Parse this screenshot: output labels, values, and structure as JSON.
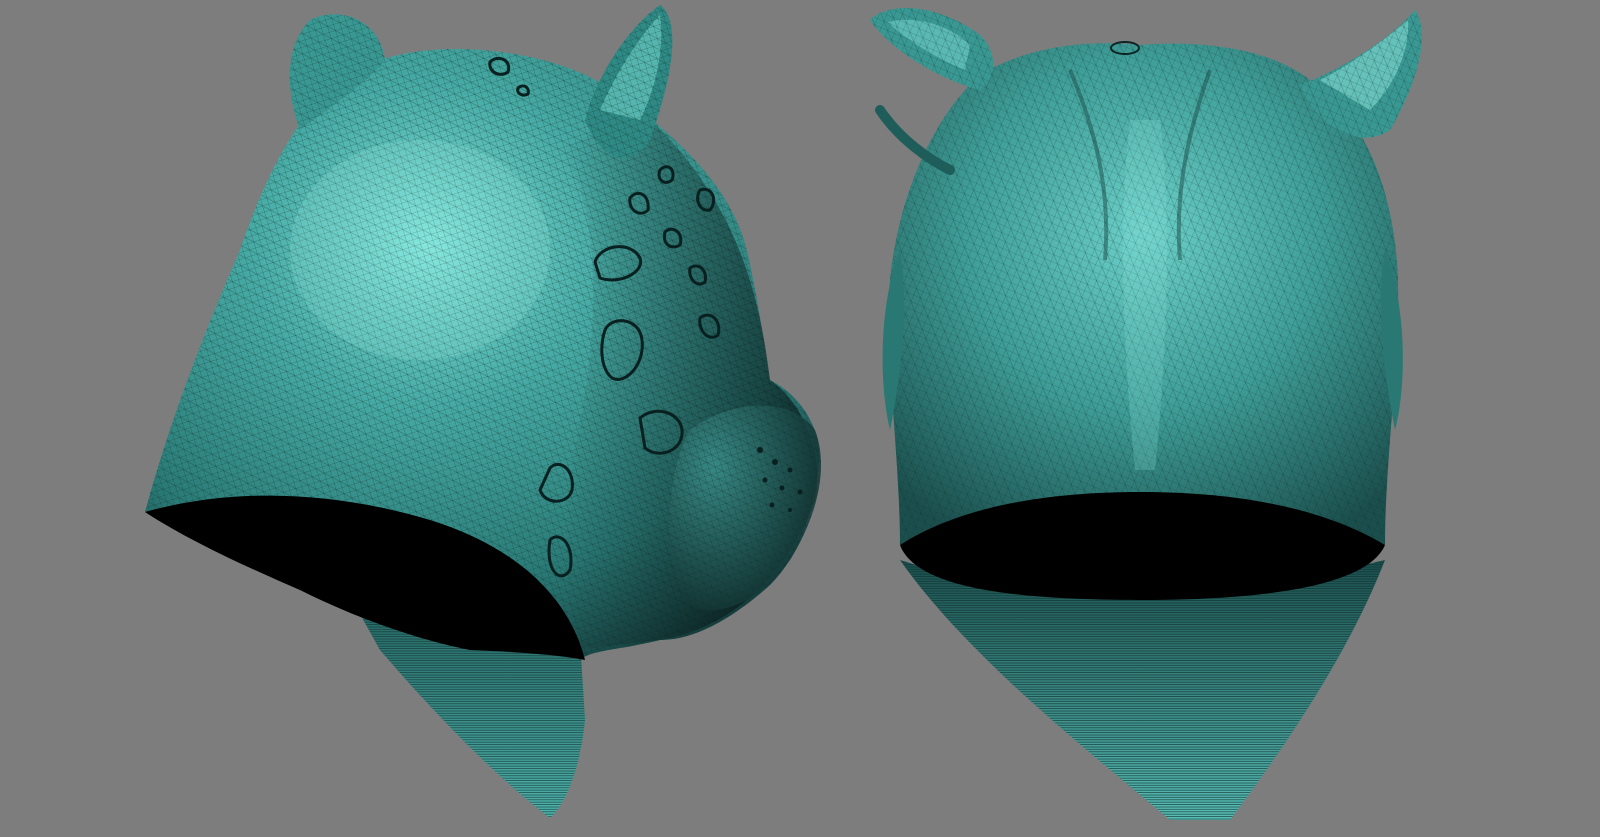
{
  "scene": {
    "background_color": "#7d7d7d",
    "mesh_color": "#3f9e9a",
    "mesh_highlight_color": "#74d6cf",
    "mesh_shadow_color": "#123a39",
    "interior_color": "#000000",
    "views": [
      {
        "id": "side",
        "subject": "leopard-head-mesh",
        "orientation": "three-quarter-side"
      },
      {
        "id": "back",
        "subject": "leopard-head-mesh",
        "orientation": "back"
      }
    ]
  }
}
